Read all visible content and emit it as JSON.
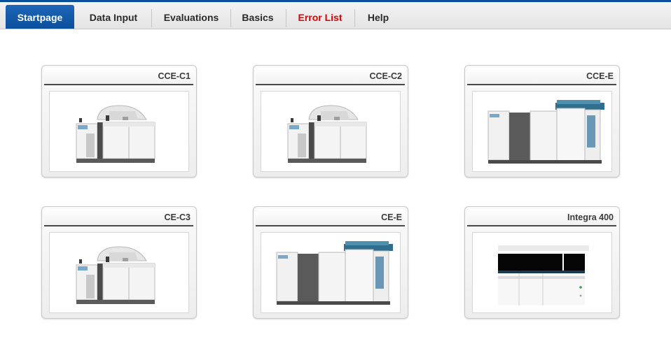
{
  "tabs": [
    {
      "label": "Startpage",
      "active": true
    },
    {
      "label": "Data Input"
    },
    {
      "label": "Evaluations"
    },
    {
      "label": "Basics"
    },
    {
      "label": "Error List",
      "color": "#e00000"
    },
    {
      "label": "Help"
    }
  ],
  "cards": [
    {
      "title": "CCE-C1",
      "icon": "analyzer-compact-icon"
    },
    {
      "title": "CCE-C2",
      "icon": "analyzer-compact-icon"
    },
    {
      "title": "CCE-E",
      "icon": "analyzer-large-icon"
    },
    {
      "title": "CE-C3",
      "icon": "analyzer-compact-icon"
    },
    {
      "title": "CE-E",
      "icon": "analyzer-large-icon"
    },
    {
      "title": "Integra 400",
      "icon": "analyzer-integra-icon"
    }
  ],
  "colors": {
    "accent": "#0b4f9c",
    "error": "#e00000"
  }
}
